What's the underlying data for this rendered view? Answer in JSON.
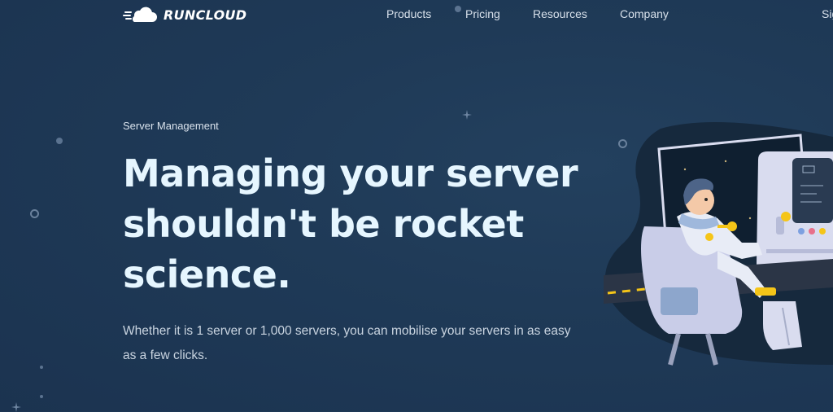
{
  "brand": {
    "name": "RUNCLOUD"
  },
  "nav": {
    "items": [
      {
        "label": "Products"
      },
      {
        "label": "Pricing"
      },
      {
        "label": "Resources"
      },
      {
        "label": "Company"
      },
      {
        "label": "Sig"
      }
    ]
  },
  "hero": {
    "eyebrow": "Server Management",
    "headline_lines": [
      "Managing your server",
      "shouldn't be rocket",
      "science."
    ],
    "subtext": "Whether it is 1 server or 1,000 servers, you can mobilise your servers in as easy as a few clicks."
  },
  "colors": {
    "background": "#1f3a57",
    "headline": "#e6f6ff",
    "accent_yellow": "#f5c518",
    "seat": "#c9cde8",
    "panel": "#d9dcef"
  },
  "icons": {
    "logo": "cloud-speed-icon",
    "illustration": "astronaut-cockpit-illustration"
  }
}
